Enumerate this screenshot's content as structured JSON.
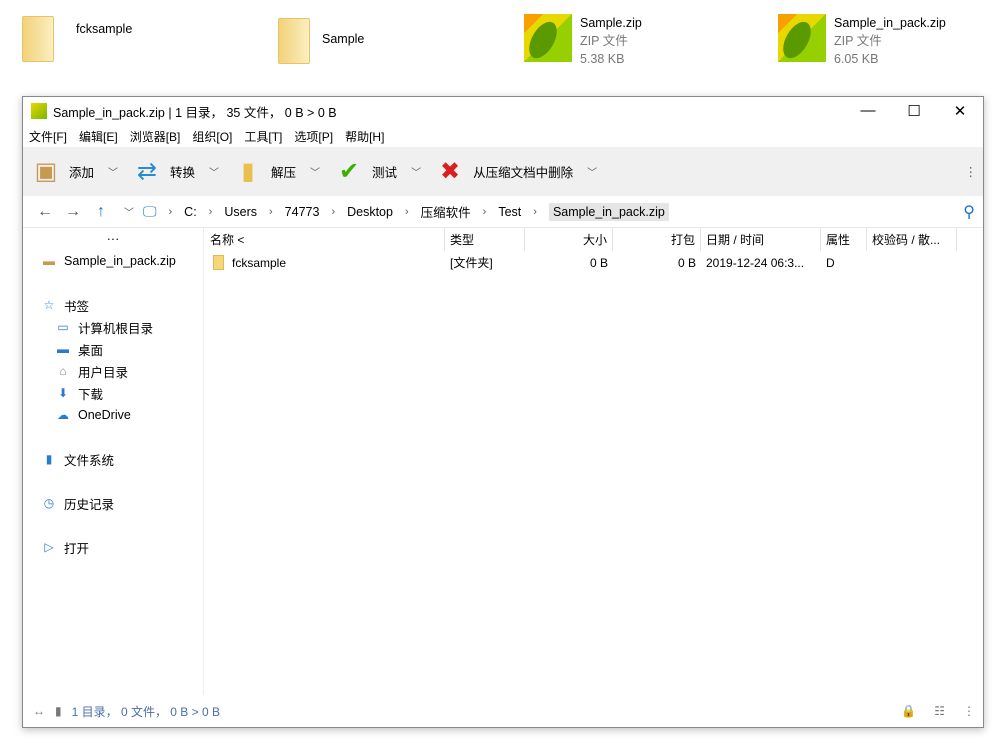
{
  "desktop": [
    {
      "name": "fcksample",
      "kind": "folder"
    },
    {
      "name": "Sample",
      "kind": "folder"
    },
    {
      "name": "Sample.zip",
      "type": "ZIP 文件",
      "size": "5.38 KB",
      "kind": "zip"
    },
    {
      "name": "Sample_in_pack.zip",
      "type": "ZIP 文件",
      "size": "6.05 KB",
      "kind": "zip"
    }
  ],
  "window": {
    "title": "Sample_in_pack.zip | 1 目录， 35 文件， 0 B > 0 B",
    "minimize": "—",
    "maximize": "☐",
    "close": "✕"
  },
  "menu": [
    "文件[F]",
    "编辑[E]",
    "浏览器[B]",
    "组织[O]",
    "工具[T]",
    "选项[P]",
    "帮助[H]"
  ],
  "toolbar": [
    {
      "label": "添加",
      "icon": "add-box-icon"
    },
    {
      "label": "转换",
      "icon": "convert-icon"
    },
    {
      "label": "解压",
      "icon": "extract-icon"
    },
    {
      "label": "测试",
      "icon": "check-icon"
    },
    {
      "label": "从压缩文档中删除",
      "icon": "delete-icon"
    }
  ],
  "address": {
    "crumbs": [
      "C:",
      "Users",
      "74773",
      "Desktop",
      "压缩软件",
      "Test",
      "Sample_in_pack.zip"
    ]
  },
  "sidebar": {
    "dots": "···",
    "archive": "Sample_in_pack.zip",
    "bookmarks": "书签",
    "items": [
      "计算机根目录",
      "桌面",
      "用户目录",
      "下载",
      "OneDrive"
    ],
    "filesystem": "文件系统",
    "history": "历史记录",
    "open": "打开"
  },
  "columns": [
    "名称 <",
    "类型",
    "大小",
    "打包",
    "日期 / 时间",
    "属性",
    "校验码 / 散..."
  ],
  "rows": [
    {
      "name": "fcksample",
      "type": "[文件夹]",
      "size": "0 B",
      "packed": "0 B",
      "date": "2019-12-24 06:3...",
      "attr": "D",
      "crc": ""
    }
  ],
  "status": "1 目录， 0 文件， 0 B > 0 B"
}
